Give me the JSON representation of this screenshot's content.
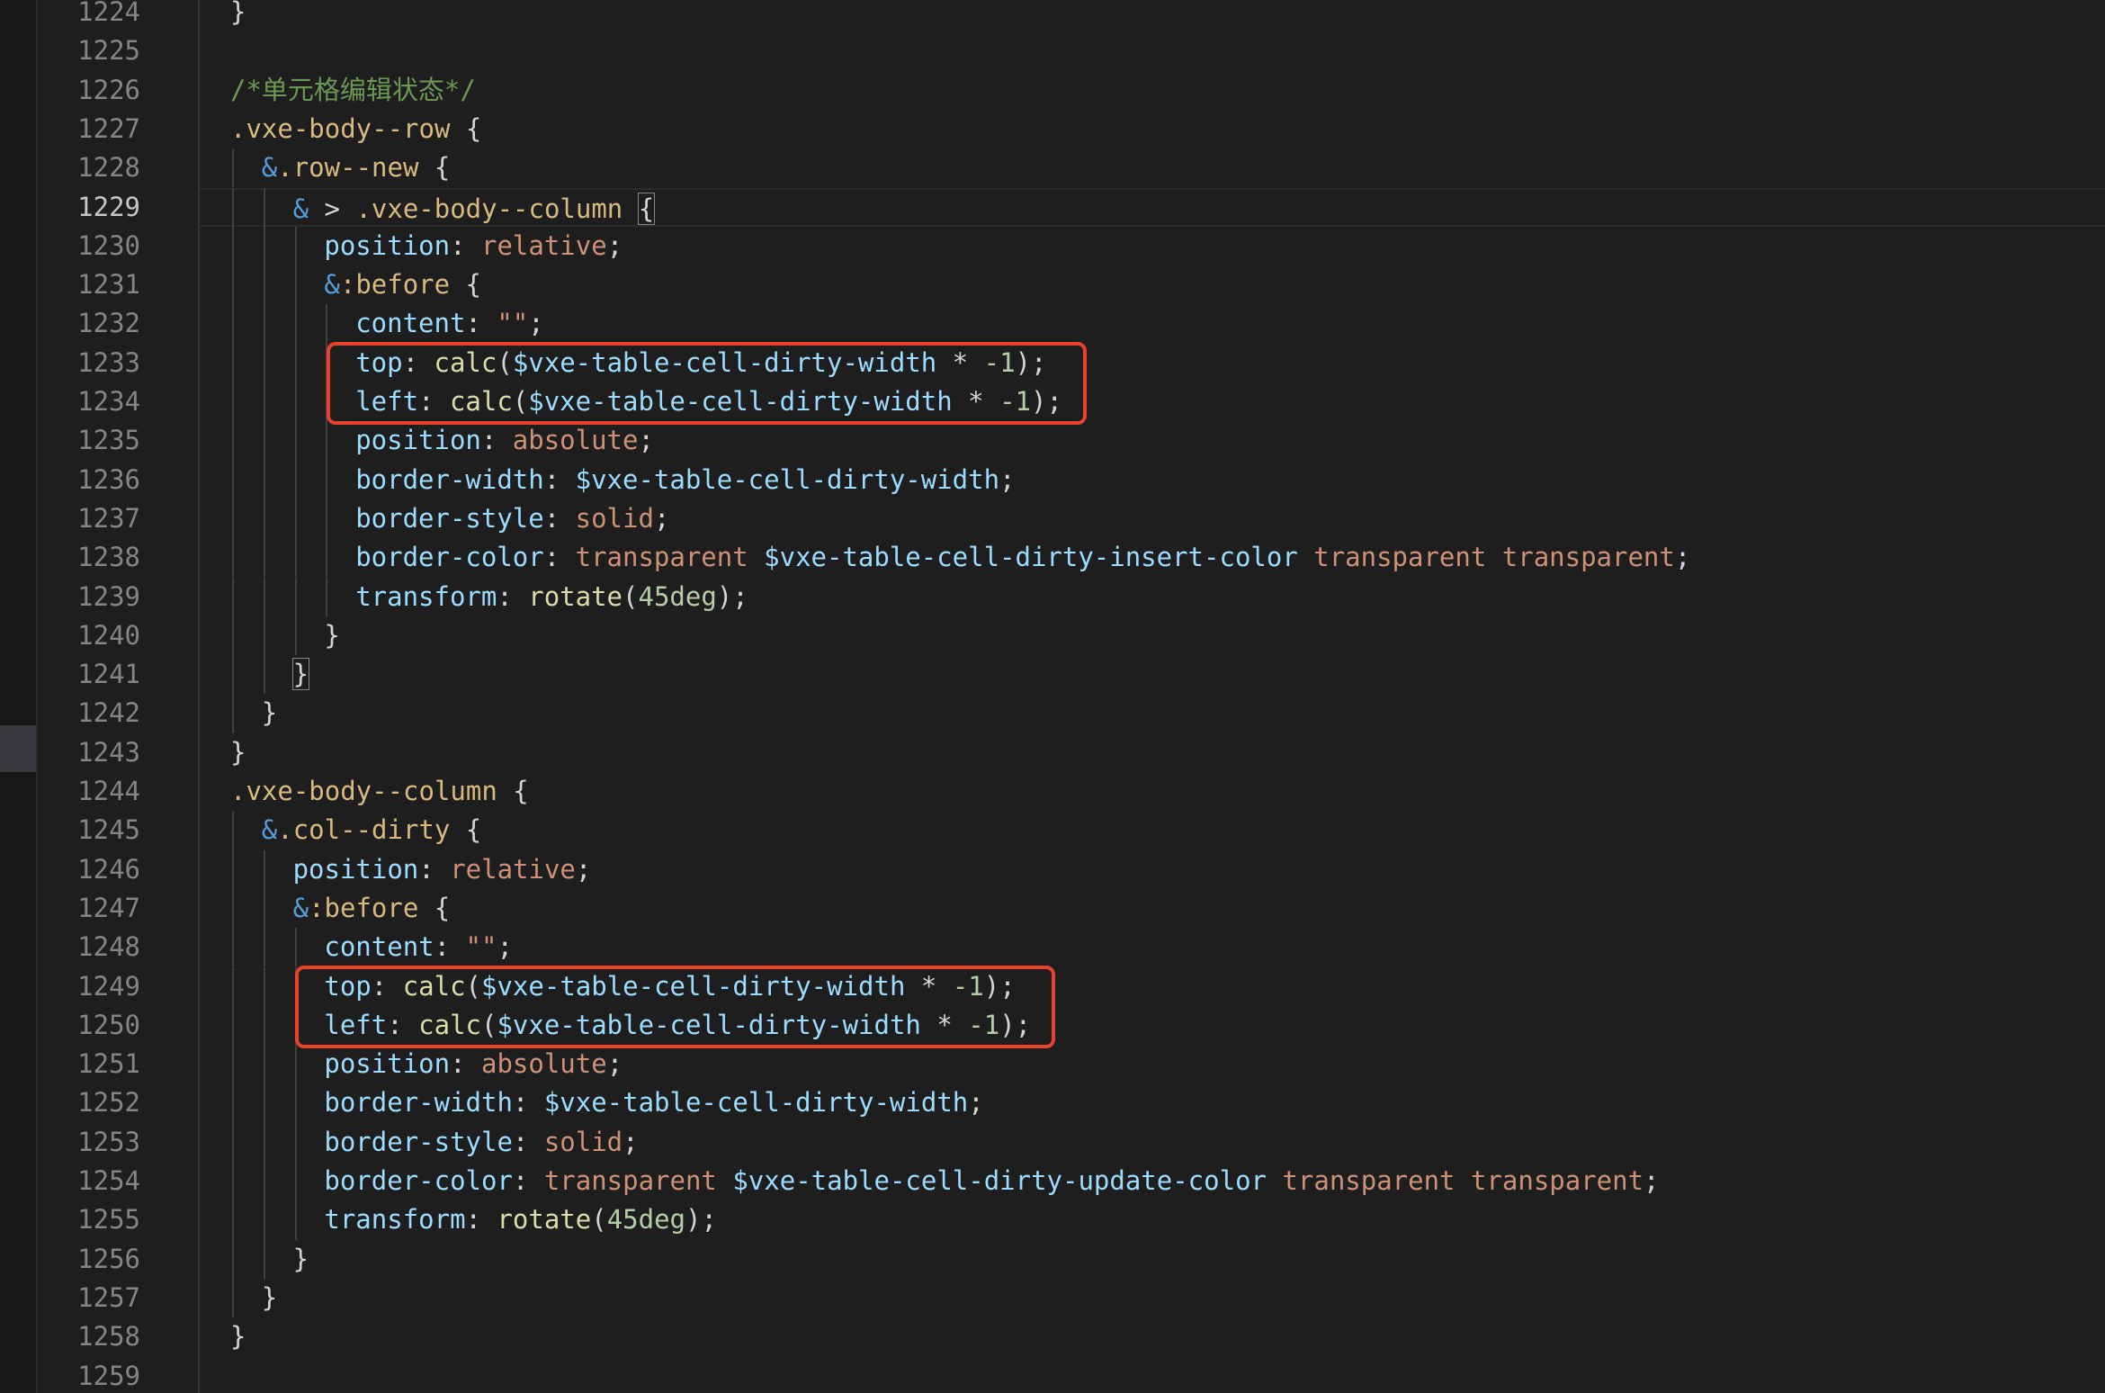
{
  "editor": {
    "active_line": 1229,
    "lines": [
      {
        "n": 1224,
        "indent": 0,
        "tokens": [
          {
            "t": "}",
            "c": "punct"
          }
        ]
      },
      {
        "n": 1225,
        "indent": 0,
        "tokens": []
      },
      {
        "n": 1226,
        "indent": 0,
        "tokens": [
          {
            "t": "/*单元格编辑状态*/",
            "c": "comment"
          }
        ]
      },
      {
        "n": 1227,
        "indent": 0,
        "tokens": [
          {
            "t": ".vxe-body--row",
            "c": "selector"
          },
          {
            "t": " {",
            "c": "punct"
          }
        ]
      },
      {
        "n": 1228,
        "indent": 1,
        "tokens": [
          {
            "t": "&",
            "c": "amp"
          },
          {
            "t": ".row--new",
            "c": "selector"
          },
          {
            "t": " {",
            "c": "punct"
          }
        ]
      },
      {
        "n": 1229,
        "indent": 2,
        "tokens": [
          {
            "t": "&",
            "c": "amp"
          },
          {
            "t": " > ",
            "c": "op"
          },
          {
            "t": ".vxe-body--column",
            "c": "selector"
          },
          {
            "t": " ",
            "c": "punct"
          },
          {
            "t": "{",
            "c": "bracket-match"
          }
        ]
      },
      {
        "n": 1230,
        "indent": 3,
        "tokens": [
          {
            "t": "position",
            "c": "prop"
          },
          {
            "t": ": ",
            "c": "punct"
          },
          {
            "t": "relative",
            "c": "value"
          },
          {
            "t": ";",
            "c": "punct"
          }
        ]
      },
      {
        "n": 1231,
        "indent": 3,
        "tokens": [
          {
            "t": "&",
            "c": "amp"
          },
          {
            "t": ":before",
            "c": "selector"
          },
          {
            "t": " {",
            "c": "punct"
          }
        ]
      },
      {
        "n": 1232,
        "indent": 4,
        "tokens": [
          {
            "t": "content",
            "c": "prop"
          },
          {
            "t": ": ",
            "c": "punct"
          },
          {
            "t": "\"\"",
            "c": "string"
          },
          {
            "t": ";",
            "c": "punct"
          }
        ]
      },
      {
        "n": 1233,
        "indent": 4,
        "tokens": [
          {
            "t": "top",
            "c": "prop"
          },
          {
            "t": ": ",
            "c": "punct"
          },
          {
            "t": "calc",
            "c": "func"
          },
          {
            "t": "(",
            "c": "punct"
          },
          {
            "t": "$vxe-table-cell-dirty-width",
            "c": "var"
          },
          {
            "t": " * ",
            "c": "op"
          },
          {
            "t": "-1",
            "c": "num"
          },
          {
            "t": ");",
            "c": "punct"
          }
        ]
      },
      {
        "n": 1234,
        "indent": 4,
        "tokens": [
          {
            "t": "left",
            "c": "prop"
          },
          {
            "t": ": ",
            "c": "punct"
          },
          {
            "t": "calc",
            "c": "func"
          },
          {
            "t": "(",
            "c": "punct"
          },
          {
            "t": "$vxe-table-cell-dirty-width",
            "c": "var"
          },
          {
            "t": " * ",
            "c": "op"
          },
          {
            "t": "-1",
            "c": "num"
          },
          {
            "t": ");",
            "c": "punct"
          }
        ]
      },
      {
        "n": 1235,
        "indent": 4,
        "tokens": [
          {
            "t": "position",
            "c": "prop"
          },
          {
            "t": ": ",
            "c": "punct"
          },
          {
            "t": "absolute",
            "c": "value"
          },
          {
            "t": ";",
            "c": "punct"
          }
        ]
      },
      {
        "n": 1236,
        "indent": 4,
        "tokens": [
          {
            "t": "border-width",
            "c": "prop"
          },
          {
            "t": ": ",
            "c": "punct"
          },
          {
            "t": "$vxe-table-cell-dirty-width",
            "c": "var"
          },
          {
            "t": ";",
            "c": "punct"
          }
        ]
      },
      {
        "n": 1237,
        "indent": 4,
        "tokens": [
          {
            "t": "border-style",
            "c": "prop"
          },
          {
            "t": ": ",
            "c": "punct"
          },
          {
            "t": "solid",
            "c": "value"
          },
          {
            "t": ";",
            "c": "punct"
          }
        ]
      },
      {
        "n": 1238,
        "indent": 4,
        "tokens": [
          {
            "t": "border-color",
            "c": "prop"
          },
          {
            "t": ": ",
            "c": "punct"
          },
          {
            "t": "transparent",
            "c": "value"
          },
          {
            "t": " ",
            "c": "punct"
          },
          {
            "t": "$vxe-table-cell-dirty-insert-color",
            "c": "var"
          },
          {
            "t": " ",
            "c": "punct"
          },
          {
            "t": "transparent",
            "c": "value"
          },
          {
            "t": " ",
            "c": "punct"
          },
          {
            "t": "transparent",
            "c": "value"
          },
          {
            "t": ";",
            "c": "punct"
          }
        ]
      },
      {
        "n": 1239,
        "indent": 4,
        "tokens": [
          {
            "t": "transform",
            "c": "prop"
          },
          {
            "t": ": ",
            "c": "punct"
          },
          {
            "t": "rotate",
            "c": "func"
          },
          {
            "t": "(",
            "c": "punct"
          },
          {
            "t": "45deg",
            "c": "num"
          },
          {
            "t": ");",
            "c": "punct"
          }
        ]
      },
      {
        "n": 1240,
        "indent": 3,
        "tokens": [
          {
            "t": "}",
            "c": "punct"
          }
        ]
      },
      {
        "n": 1241,
        "indent": 2,
        "tokens": [
          {
            "t": "}",
            "c": "bracket-match"
          }
        ]
      },
      {
        "n": 1242,
        "indent": 1,
        "tokens": [
          {
            "t": "}",
            "c": "punct"
          }
        ]
      },
      {
        "n": 1243,
        "indent": 0,
        "tokens": [
          {
            "t": "}",
            "c": "punct"
          }
        ]
      },
      {
        "n": 1244,
        "indent": 0,
        "tokens": [
          {
            "t": ".vxe-body--column",
            "c": "selector"
          },
          {
            "t": " {",
            "c": "punct"
          }
        ]
      },
      {
        "n": 1245,
        "indent": 1,
        "tokens": [
          {
            "t": "&",
            "c": "amp"
          },
          {
            "t": ".col--dirty",
            "c": "selector"
          },
          {
            "t": " {",
            "c": "punct"
          }
        ]
      },
      {
        "n": 1246,
        "indent": 2,
        "tokens": [
          {
            "t": "position",
            "c": "prop"
          },
          {
            "t": ": ",
            "c": "punct"
          },
          {
            "t": "relative",
            "c": "value"
          },
          {
            "t": ";",
            "c": "punct"
          }
        ]
      },
      {
        "n": 1247,
        "indent": 2,
        "tokens": [
          {
            "t": "&",
            "c": "amp"
          },
          {
            "t": ":before",
            "c": "selector"
          },
          {
            "t": " {",
            "c": "punct"
          }
        ]
      },
      {
        "n": 1248,
        "indent": 3,
        "tokens": [
          {
            "t": "content",
            "c": "prop"
          },
          {
            "t": ": ",
            "c": "punct"
          },
          {
            "t": "\"\"",
            "c": "string"
          },
          {
            "t": ";",
            "c": "punct"
          }
        ]
      },
      {
        "n": 1249,
        "indent": 3,
        "tokens": [
          {
            "t": "top",
            "c": "prop"
          },
          {
            "t": ": ",
            "c": "punct"
          },
          {
            "t": "calc",
            "c": "func"
          },
          {
            "t": "(",
            "c": "punct"
          },
          {
            "t": "$vxe-table-cell-dirty-width",
            "c": "var"
          },
          {
            "t": " * ",
            "c": "op"
          },
          {
            "t": "-1",
            "c": "num"
          },
          {
            "t": ");",
            "c": "punct"
          }
        ]
      },
      {
        "n": 1250,
        "indent": 3,
        "tokens": [
          {
            "t": "left",
            "c": "prop"
          },
          {
            "t": ": ",
            "c": "punct"
          },
          {
            "t": "calc",
            "c": "func"
          },
          {
            "t": "(",
            "c": "punct"
          },
          {
            "t": "$vxe-table-cell-dirty-width",
            "c": "var"
          },
          {
            "t": " * ",
            "c": "op"
          },
          {
            "t": "-1",
            "c": "num"
          },
          {
            "t": ");",
            "c": "punct"
          }
        ]
      },
      {
        "n": 1251,
        "indent": 3,
        "tokens": [
          {
            "t": "position",
            "c": "prop"
          },
          {
            "t": ": ",
            "c": "punct"
          },
          {
            "t": "absolute",
            "c": "value"
          },
          {
            "t": ";",
            "c": "punct"
          }
        ]
      },
      {
        "n": 1252,
        "indent": 3,
        "tokens": [
          {
            "t": "border-width",
            "c": "prop"
          },
          {
            "t": ": ",
            "c": "punct"
          },
          {
            "t": "$vxe-table-cell-dirty-width",
            "c": "var"
          },
          {
            "t": ";",
            "c": "punct"
          }
        ]
      },
      {
        "n": 1253,
        "indent": 3,
        "tokens": [
          {
            "t": "border-style",
            "c": "prop"
          },
          {
            "t": ": ",
            "c": "punct"
          },
          {
            "t": "solid",
            "c": "value"
          },
          {
            "t": ";",
            "c": "punct"
          }
        ]
      },
      {
        "n": 1254,
        "indent": 3,
        "tokens": [
          {
            "t": "border-color",
            "c": "prop"
          },
          {
            "t": ": ",
            "c": "punct"
          },
          {
            "t": "transparent",
            "c": "value"
          },
          {
            "t": " ",
            "c": "punct"
          },
          {
            "t": "$vxe-table-cell-dirty-update-color",
            "c": "var"
          },
          {
            "t": " ",
            "c": "punct"
          },
          {
            "t": "transparent",
            "c": "value"
          },
          {
            "t": " ",
            "c": "punct"
          },
          {
            "t": "transparent",
            "c": "value"
          },
          {
            "t": ";",
            "c": "punct"
          }
        ]
      },
      {
        "n": 1255,
        "indent": 3,
        "tokens": [
          {
            "t": "transform",
            "c": "prop"
          },
          {
            "t": ": ",
            "c": "punct"
          },
          {
            "t": "rotate",
            "c": "func"
          },
          {
            "t": "(",
            "c": "punct"
          },
          {
            "t": "45deg",
            "c": "num"
          },
          {
            "t": ");",
            "c": "punct"
          }
        ]
      },
      {
        "n": 1256,
        "indent": 2,
        "tokens": [
          {
            "t": "}",
            "c": "punct"
          }
        ]
      },
      {
        "n": 1257,
        "indent": 1,
        "tokens": [
          {
            "t": "}",
            "c": "punct"
          }
        ]
      },
      {
        "n": 1258,
        "indent": 0,
        "tokens": [
          {
            "t": "}",
            "c": "punct"
          }
        ]
      },
      {
        "n": 1259,
        "indent": 0,
        "tokens": []
      }
    ]
  },
  "annotations": [
    {
      "kind": "highlight-box",
      "color": "#e8412c",
      "from_line": 1233,
      "to_line": 1234
    },
    {
      "kind": "highlight-box",
      "color": "#e8412c",
      "from_line": 1249,
      "to_line": 1250
    }
  ],
  "theme": {
    "background": "#1e1e1e",
    "selector": "#d7ba7d",
    "property": "#9cdcfe",
    "value": "#ce9178",
    "function": "#dcdcaa",
    "number": "#b5cea8",
    "comment": "#6a9955",
    "keyword": "#569cd6"
  }
}
